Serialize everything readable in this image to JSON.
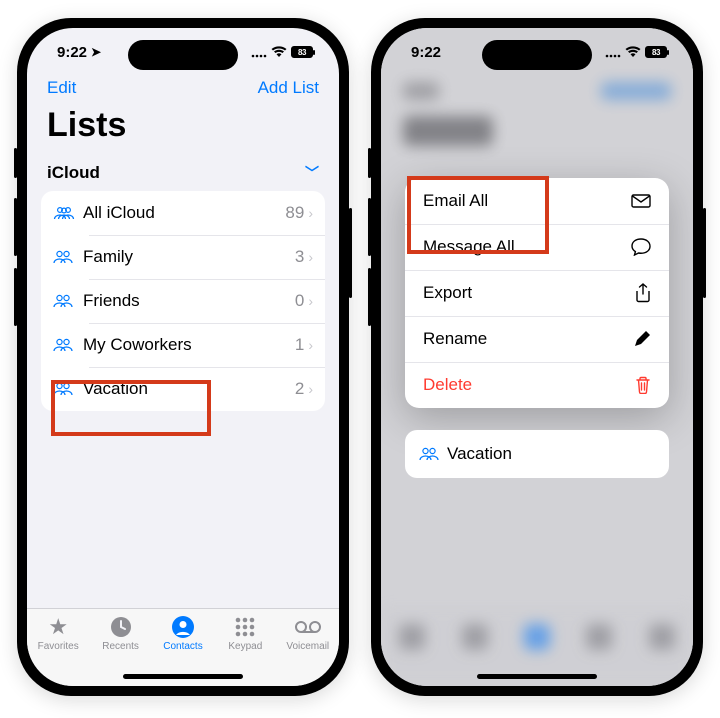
{
  "status": {
    "time": "9:22",
    "battery": "83"
  },
  "screen1": {
    "nav": {
      "edit": "Edit",
      "addList": "Add List"
    },
    "title": "Lists",
    "section": {
      "header": "iCloud"
    },
    "rows": [
      {
        "label": "All iCloud",
        "count": "89"
      },
      {
        "label": "Family",
        "count": "3"
      },
      {
        "label": "Friends",
        "count": "0"
      },
      {
        "label": "My Coworkers",
        "count": "1"
      },
      {
        "label": "Vacation",
        "count": "2"
      }
    ],
    "tabs": {
      "favorites": "Favorites",
      "recents": "Recents",
      "contacts": "Contacts",
      "keypad": "Keypad",
      "voicemail": "Voicemail"
    }
  },
  "screen2": {
    "menu": {
      "emailAll": "Email All",
      "messageAll": "Message All",
      "export": "Export",
      "rename": "Rename",
      "delete": "Delete"
    },
    "selected": {
      "label": "Vacation"
    }
  }
}
